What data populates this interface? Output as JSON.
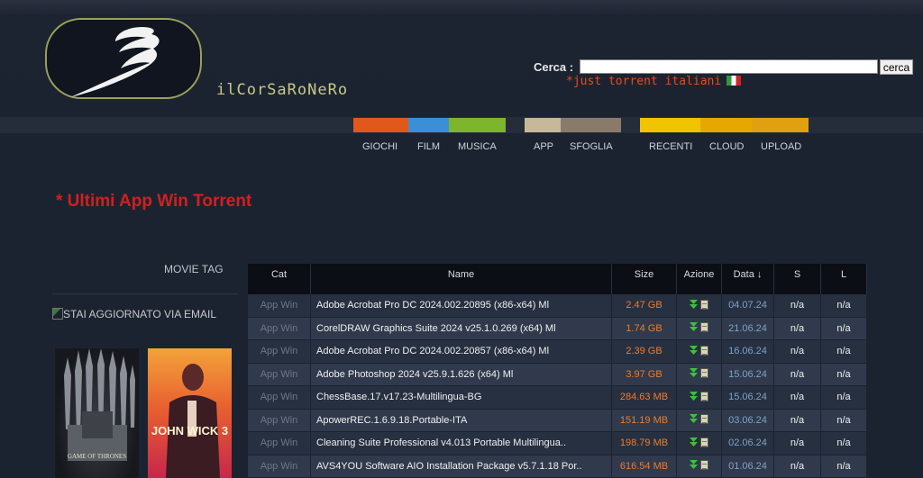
{
  "header": {
    "site_name": "ilCorSaRoNeRo",
    "search_label": "Cerca :",
    "search_value": "",
    "search_button": "cerca",
    "tagline": "*just torrent italiani"
  },
  "nav": {
    "items": [
      {
        "label": "GIOCHI",
        "color": "#e0581a"
      },
      {
        "label": "FILM",
        "color": "#3a8fd6"
      },
      {
        "label": "MUSICA",
        "color": "#7db52c"
      },
      {
        "label": "APP",
        "color": "#c8b89a"
      },
      {
        "label": "SFOGLIA",
        "color": "#8a7a6a"
      },
      {
        "label": "RECENTI",
        "color": "#f0c400"
      },
      {
        "label": "CLOUD",
        "color": "#e6a800"
      },
      {
        "label": "UPLOAD",
        "color": "#e0a010"
      }
    ]
  },
  "page_title": "* Ultimi App Win Torrent",
  "sidebar": {
    "movie_tag": "MOVIE TAG",
    "email_link": "STAI AGGIORNATO VIA EMAIL",
    "poster_got_caption": "GAME OF THRONES",
    "poster_jw_caption": "JOHN WICK 3"
  },
  "table": {
    "headers": {
      "cat": "Cat",
      "name": "Name",
      "size": "Size",
      "azione": "Azione",
      "data": "Data ↓",
      "s": "S",
      "l": "L"
    },
    "rows": [
      {
        "cat": "App Win",
        "name": "Adobe Acrobat Pro DC 2024.002.20895 (x86-x64) Ml",
        "size": "2.47 GB",
        "date": "04.07.24",
        "s": "n/a",
        "l": "n/a"
      },
      {
        "cat": "App Win",
        "name": "CorelDRAW Graphics Suite 2024 v25.1.0.269 (x64) Ml",
        "size": "1.74 GB",
        "date": "21.06.24",
        "s": "n/a",
        "l": "n/a"
      },
      {
        "cat": "App Win",
        "name": "Adobe Acrobat Pro DC 2024.002.20857 (x86-x64) Ml",
        "size": "2.39 GB",
        "date": "16.06.24",
        "s": "n/a",
        "l": "n/a"
      },
      {
        "cat": "App Win",
        "name": "Adobe Photoshop 2024 v25.9.1.626 (x64) Ml",
        "size": "3.97 GB",
        "date": "15.06.24",
        "s": "n/a",
        "l": "n/a"
      },
      {
        "cat": "App Win",
        "name": "ChessBase.17.v17.23-Multilingua-BG",
        "size": "284.63 MB",
        "date": "15.06.24",
        "s": "n/a",
        "l": "n/a"
      },
      {
        "cat": "App Win",
        "name": "ApowerREC.1.6.9.18.Portable-ITA",
        "size": "151.19 MB",
        "date": "03.06.24",
        "s": "n/a",
        "l": "n/a"
      },
      {
        "cat": "App Win",
        "name": "Cleaning Suite Professional v4.013 Portable Multilingua..",
        "size": "198.79 MB",
        "date": "02.06.24",
        "s": "n/a",
        "l": "n/a"
      },
      {
        "cat": "App Win",
        "name": "AVS4YOU Software AIO Installation Package v5.7.1.18 Por..",
        "size": "616.54 MB",
        "date": "01.06.24",
        "s": "n/a",
        "l": "n/a"
      }
    ]
  }
}
